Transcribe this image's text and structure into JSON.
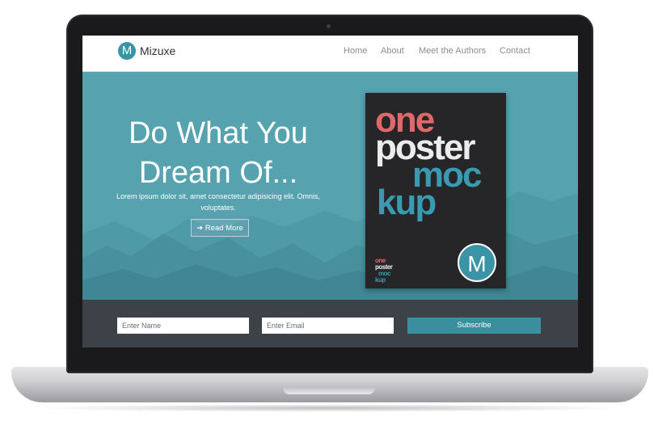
{
  "navbar": {
    "logo_letter": "M",
    "brand": "Mizuxe",
    "links": [
      "Home",
      "About",
      "Meet the Authors",
      "Contact"
    ]
  },
  "hero": {
    "title_line1": "Do What You",
    "title_line2": "Dream Of...",
    "text": "Lorem ipsum dolor sit, amet consectetur adipisicing elit. Omnis, voluptates.",
    "button_icon": "arrow-right-icon",
    "button_label": "Read More"
  },
  "poster": {
    "lines": [
      "one",
      "poster",
      "moc",
      "kup"
    ],
    "badge_letter": "M",
    "colors": {
      "one": "#e0686a",
      "poster": "#ececec",
      "mockup": "#3a9bb0"
    }
  },
  "subscribe": {
    "name_placeholder": "Enter Name",
    "email_placeholder": "Enter Email",
    "button_label": "Subscribe"
  },
  "colors": {
    "accent": "#3a94a6",
    "hero_bg": "#56a2af",
    "subscribe_bg": "#3d4148"
  }
}
